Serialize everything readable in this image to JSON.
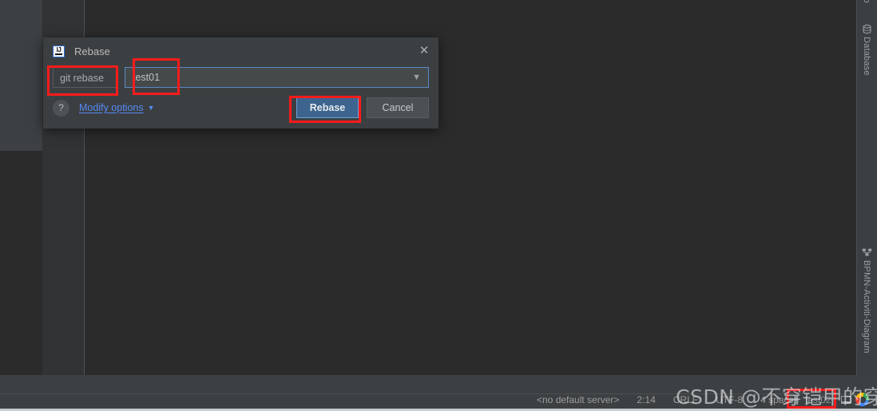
{
  "window": {
    "background_color": "#2b2b2b",
    "editor_background": "#2b2b2b",
    "panel_background": "#3c3f41"
  },
  "right_tabs": [
    {
      "label": "sito",
      "icon": "partial-tab-icon"
    },
    {
      "label": "Database",
      "icon": "database-icon"
    },
    {
      "label": "BPMN-Activiti-Diagram",
      "icon": "diagram-icon"
    }
  ],
  "dialog": {
    "logo_text": "IJ",
    "title": "Rebase",
    "close_icon": "close-icon",
    "command_label": "git rebase",
    "branch_value": "test01",
    "branch_arrow_icon": "chevron-down-icon",
    "help_label": "?",
    "modify_options_label": "Modify options",
    "modify_options_chevron": "chevron-down-icon",
    "primary_button": "Rebase",
    "cancel_button": "Cancel",
    "primary_color": "#3d648f",
    "focus_border_color": "#5a8bc4"
  },
  "annotations": {
    "highlight_color": "#fc1b1b",
    "boxes": [
      "git-rebase-label",
      "branch-combobox",
      "rebase-button",
      "status-branch"
    ]
  },
  "status_bar": {
    "items": [
      "<no default server>",
      "2:14",
      "CRLF",
      "UTF-8",
      "4 spaces"
    ],
    "branch": "test02",
    "branch_icon": "git-branch-icon",
    "tray_icon": "notification-tray-icon",
    "browser_icon": "google-icon"
  },
  "watermark": {
    "text": "CSDN @不穿铠甲的穿山甲"
  }
}
